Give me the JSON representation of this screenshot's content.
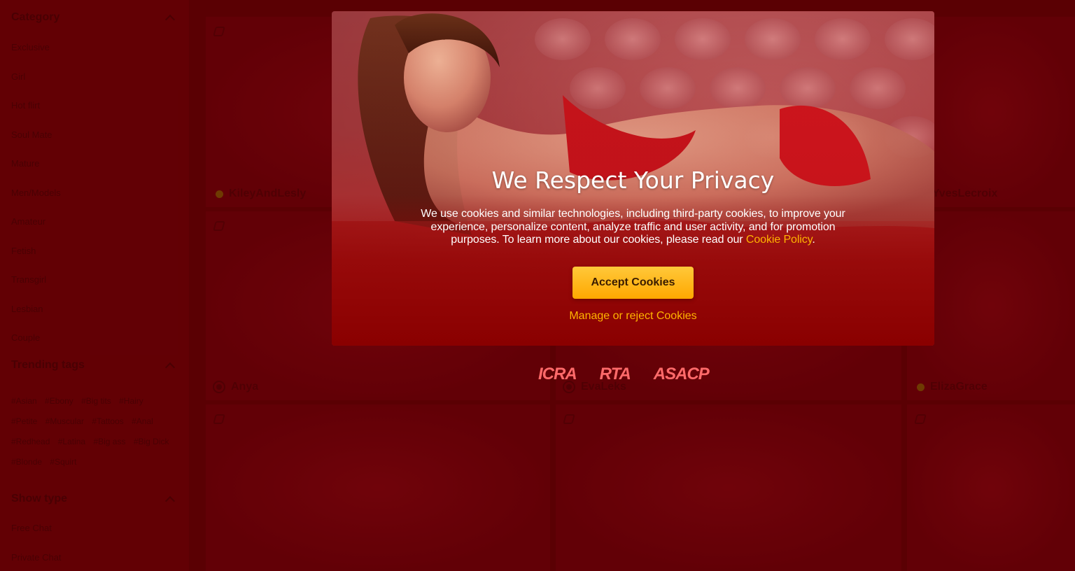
{
  "sidebar": {
    "category": {
      "title": "Category",
      "items": [
        "Exclusive",
        "Girl",
        "Hot flirt",
        "Soul Mate",
        "Mature",
        "Men/Models",
        "Amateur",
        "Fetish",
        "Transgirl",
        "Lesbian",
        "Couple"
      ]
    },
    "trending": {
      "title": "Trending tags",
      "tags": [
        "#Asian",
        "#Ebony",
        "#Big tits",
        "#Hairy",
        "#Petite",
        "#Muscular",
        "#Tattoos",
        "#Anal",
        "#Redhead",
        "#Latina",
        "#Big ass",
        "#Big Dick",
        "#Blonde",
        "#Squirt"
      ]
    },
    "show_type": {
      "title": "Show type",
      "items": [
        "Free Chat",
        "Private Chat"
      ]
    }
  },
  "cards": [
    {
      "name": "KileyAndLesly",
      "status": "online"
    },
    {
      "name": "",
      "status": "online"
    },
    {
      "name": "YvesLecroix",
      "status": "online"
    },
    {
      "name": "Anya",
      "status": "private"
    },
    {
      "name": "EvaLeks",
      "status": "private"
    },
    {
      "name": "ElizaGrace",
      "status": "online"
    },
    {
      "name": "",
      "status": ""
    },
    {
      "name": "",
      "status": ""
    },
    {
      "name": "",
      "status": ""
    }
  ],
  "modal": {
    "title": "We Respect Your Privacy",
    "body": "We use cookies and similar technologies, including third-party cookies, to improve your experience, personalize content, analyze traffic and user activity, and for promotion purposes. To learn more about our cookies, please read our",
    "policy_link": "Cookie Policy",
    "body_end": ".",
    "accept_label": "Accept Cookies",
    "manage_label": "Manage or reject Cookies"
  },
  "trust_logos": [
    "ICRA",
    "RTA",
    "ASACP"
  ],
  "colors": {
    "accent": "#ffb400",
    "button_top": "#ffc83a",
    "button_bottom": "#ffa800",
    "page_bg": "#4a0003",
    "logo": "#ff6a6a"
  }
}
